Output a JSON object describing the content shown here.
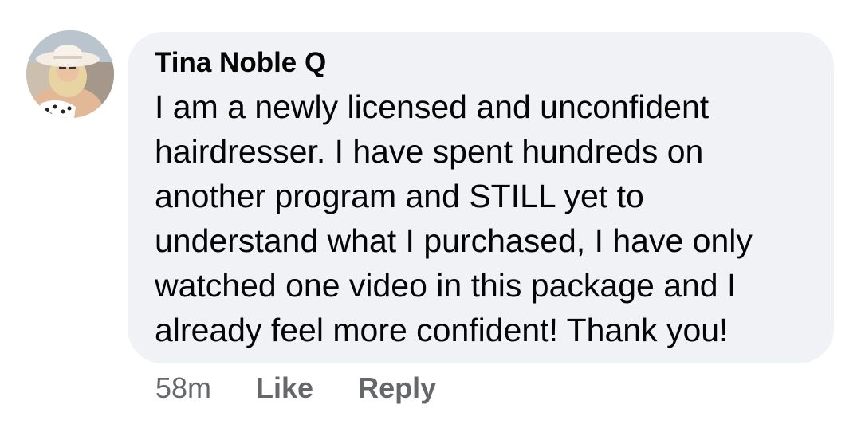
{
  "comment": {
    "author": "Tina Noble Q",
    "text_lines": [
      "I am a newly licensed and unconfident",
      "hairdresser. I have spent hundreds on",
      "another program and STILL yet to",
      "understand what I purchased, I have only",
      "watched one video in this package and I",
      "already feel more confident! Thank you!"
    ],
    "timestamp": "58m",
    "like_label": "Like",
    "reply_label": "Reply",
    "avatar_icon": "profile-photo-woman-sunhat"
  },
  "colors": {
    "bubble_bg": "#f0f2f5",
    "text": "#050505",
    "secondary_text": "#65676b"
  }
}
